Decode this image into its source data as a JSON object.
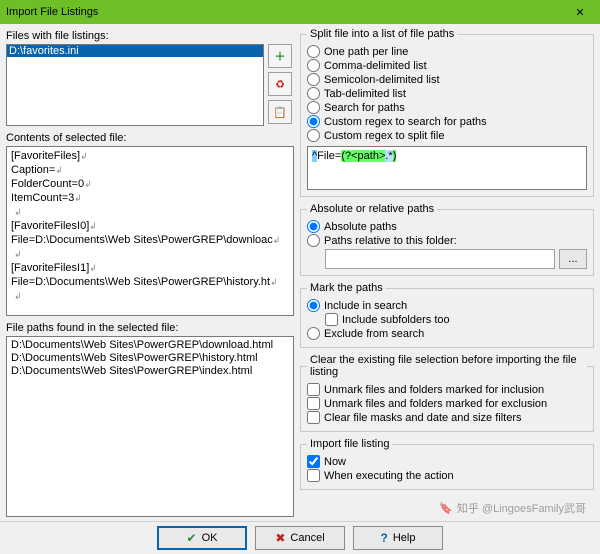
{
  "window": {
    "title": "Import File Listings",
    "close_glyph": "✕"
  },
  "left": {
    "files_label": "Files with file listings:",
    "file_items": [
      "D:\\favorites.ini"
    ],
    "tool_add_glyph": "＋",
    "tool_recycle_glyph": "♻",
    "tool_paste_glyph": "📋",
    "contents_label": "Contents of selected file:",
    "contents_lines": [
      "[FavoriteFiles]",
      "Caption=",
      "FolderCount=0",
      "ItemCount=3",
      "",
      "[FavoriteFilesI0]",
      "File=D:\\Documents\\Web Sites\\PowerGREP\\downloac",
      "",
      "[FavoriteFilesI1]",
      "File=D:\\Documents\\Web Sites\\PowerGREP\\history.ht",
      ""
    ],
    "paths_label": "File paths found in the selected file:",
    "found_paths": [
      "D:\\Documents\\Web Sites\\PowerGREP\\download.html",
      "D:\\Documents\\Web Sites\\PowerGREP\\history.html",
      "D:\\Documents\\Web Sites\\PowerGREP\\index.html"
    ]
  },
  "split": {
    "legend": "Split file into a list of file paths",
    "opt_one": "One path per line",
    "opt_comma": "Comma-delimited list",
    "opt_semi": "Semicolon-delimited list",
    "opt_tab": "Tab-delimited list",
    "opt_search": "Search for paths",
    "opt_custom_search": "Custom regex to search for paths",
    "opt_custom_split": "Custom regex to split file",
    "regex_anchor": "^",
    "regex_literal": "File=",
    "regex_group": "(?<path>",
    "regex_dot": ".*",
    "regex_close": ")"
  },
  "abs": {
    "legend": "Absolute or relative paths",
    "opt_abs": "Absolute paths",
    "opt_rel": "Paths relative to this folder:",
    "folder_value": "",
    "browse_label": "..."
  },
  "mark": {
    "legend": "Mark the paths",
    "opt_include": "Include in search",
    "chk_sub": "Include subfolders too",
    "opt_exclude": "Exclude from search"
  },
  "clear": {
    "legend": "Clear the existing file selection before importing the file listing",
    "chk_inc": "Unmark files and folders marked for inclusion",
    "chk_exc": "Unmark files and folders marked for exclusion",
    "chk_masks": "Clear file masks and date and size filters"
  },
  "import": {
    "legend": "Import file listing",
    "chk_now": "Now",
    "chk_exec": "When executing the action"
  },
  "buttons": {
    "ok": "OK",
    "cancel": "Cancel",
    "help": "Help",
    "ok_icon": "✔",
    "cancel_icon": "✖",
    "help_icon": "?"
  },
  "watermark": "知乎 @LingoesFamily武哥"
}
